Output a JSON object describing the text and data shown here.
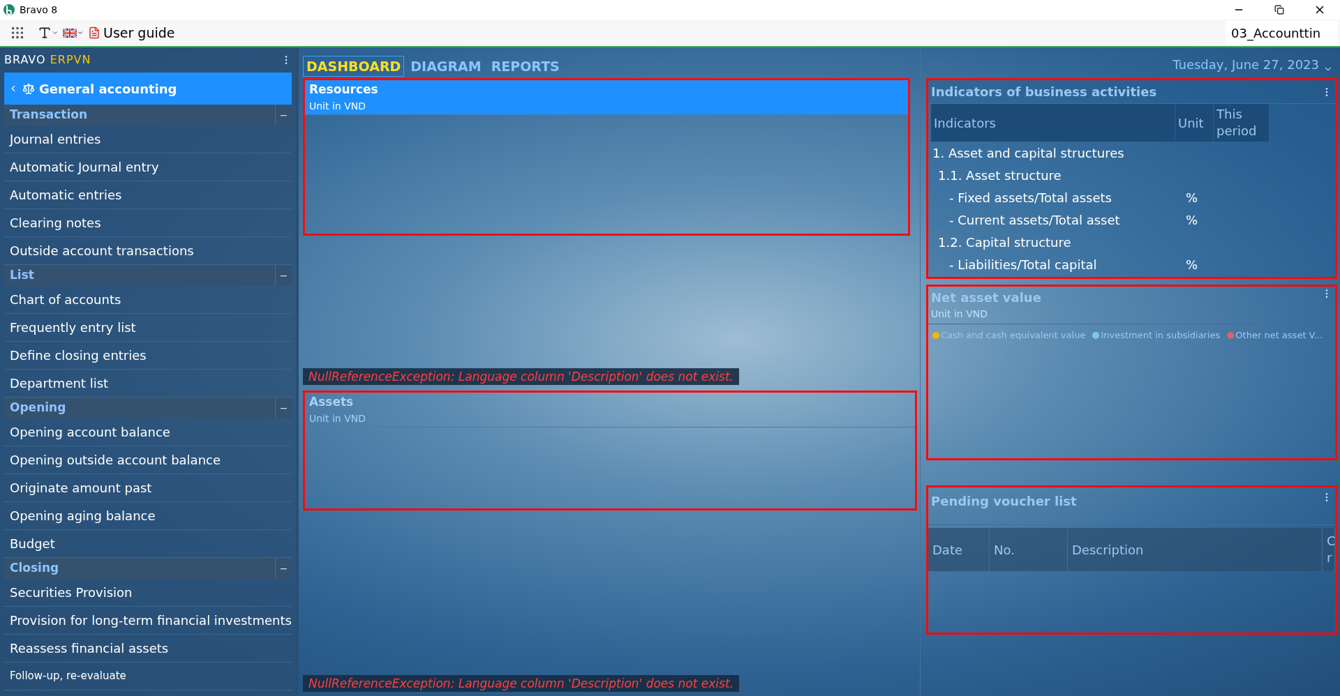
{
  "window": {
    "title": "Bravo 8"
  },
  "toolbar": {
    "guide": "User guide",
    "company": "03_Accounttin"
  },
  "sidebar": {
    "brand": [
      "BRAVO",
      "ERPVN"
    ],
    "module": "General accounting",
    "sections": [
      {
        "title": "Transaction",
        "toggle": "−",
        "expanded": true,
        "items": [
          "Journal entries",
          "Automatic Journal entry",
          "Automatic entries",
          "Clearing notes",
          "Outside account transactions"
        ]
      },
      {
        "title": "List",
        "toggle": "−",
        "expanded": true,
        "items": [
          "Chart of accounts",
          "Frequently entry list",
          "Define closing entries",
          "Department list"
        ]
      },
      {
        "title": "Opening",
        "toggle": "−",
        "expanded": true,
        "items": [
          "Opening account balance",
          "Opening outside account balance",
          "Originate amount past",
          "Opening aging balance",
          "Budget"
        ]
      },
      {
        "title": "Closing",
        "toggle": "−",
        "expanded": true,
        "items": [
          "Securities Provision",
          "Provision for long-term financial investments",
          "Reassess financial assets",
          "Follow-up, re-evaluate"
        ]
      }
    ]
  },
  "tabs": [
    {
      "label": "DASHBOARD",
      "selected": true
    },
    {
      "label": "DIAGRAM",
      "selected": false
    },
    {
      "label": "REPORTS",
      "selected": false
    }
  ],
  "date": "Tuesday, June 27, 2023",
  "center_panels": [
    {
      "title": "Resources",
      "unit": "Unit in  VND",
      "selected": true,
      "highlighted": true,
      "error": "NullReferenceException: Language column 'Description' does not exist."
    },
    {
      "title": "Assets",
      "unit": "Unit in  VND",
      "selected": false,
      "highlighted": true,
      "error": "NullReferenceException: Language column 'Description' does not exist."
    }
  ],
  "indicators": {
    "title": "Indicators of business activities",
    "highlighted": true,
    "columns": [
      "Indicators",
      "Unit",
      "This period"
    ],
    "rows": [
      {
        "label": "1. Asset and capital structures",
        "children": [
          {
            "label": "1.1. Asset structure",
            "children": [
              {
                "label": "- Fixed assets/Total assets",
                "unit": "%"
              },
              {
                "label": "- Current assets/Total asset",
                "unit": "%"
              }
            ]
          },
          {
            "label": "1.2. Capital structure",
            "children": [
              {
                "label": "- Liabilities/Total capital",
                "unit": "%"
              }
            ]
          }
        ]
      }
    ]
  },
  "net_asset": {
    "title": "Net asset value",
    "unit": "Unit in  VND",
    "highlighted": true,
    "legend": [
      {
        "label": "Cash and cash equivalent value",
        "color": "#f5b800"
      },
      {
        "label": "Investment in subsidiaries",
        "color": "#7ec8e3"
      },
      {
        "label": "Other net asset V...",
        "color": "#e0606e"
      }
    ]
  },
  "pending_vouchers": {
    "title": "Pending voucher list",
    "highlighted": true,
    "columns": [
      "Date",
      "No.",
      "Description",
      "C r"
    ]
  }
}
